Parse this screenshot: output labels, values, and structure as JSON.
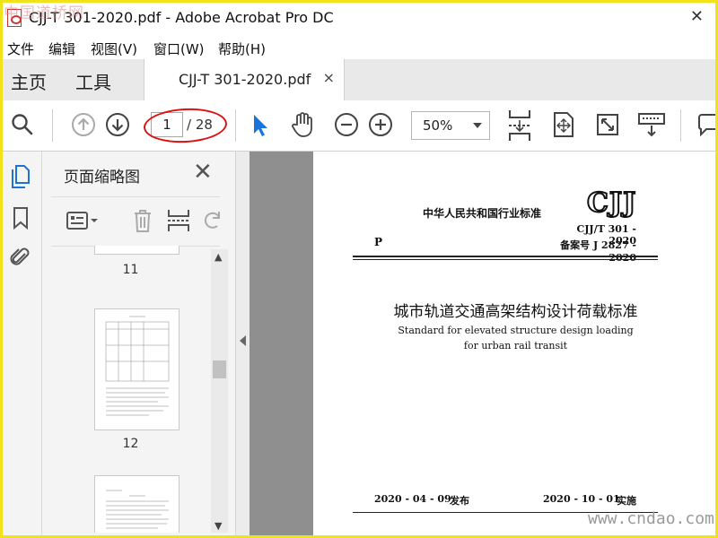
{
  "window": {
    "title": "CJJ-T 301-2020.pdf - Adobe Acrobat Pro DC",
    "watermark_top": "中国道桥网",
    "watermark_bottom": "www.cndao.com",
    "close_glyph": "✕"
  },
  "menu": [
    "文件",
    "编辑",
    "视图(V)",
    "窗口(W)",
    "帮助(H)"
  ],
  "tabs": {
    "home": "主页",
    "tools": "工具",
    "document": "CJJ-T 301-2020.pdf",
    "close_glyph": "×"
  },
  "toolbar": {
    "current_page": "1",
    "page_total": "/ 28",
    "zoom": "50%",
    "icons": [
      "search-icon",
      "previous-page-icon",
      "next-page-icon",
      "select-arrow-icon",
      "hand-tool-icon",
      "zoom-out-icon",
      "zoom-in-icon",
      "scrolling-mode-icon",
      "fit-page-icon",
      "full-screen-icon",
      "keyboard-icon",
      "comment-icon"
    ]
  },
  "left_nav": {
    "icons": [
      "page-thumbnails-icon",
      "bookmarks-icon",
      "attachments-icon"
    ]
  },
  "thumbnail_panel": {
    "title": "页面缩略图",
    "close_glyph": "✕",
    "thumbnails": [
      {
        "page": "11"
      },
      {
        "page": "12"
      }
    ]
  },
  "document": {
    "standard_title": "中华人民共和国行业标准",
    "logo": "CJJ",
    "category": "P",
    "code": "CJJ/T 301 - 2020",
    "record": "备案号  J 2827 - 2020",
    "title_cn": "城市轨道交通高架结构设计荷载标准",
    "title_en_1": "Standard for elevated structure design loading",
    "title_en_2": "for urban rail transit",
    "publish_date": "2020 - 04 - 09",
    "publish_label": "发布",
    "implement_date": "2020 - 10 - 01",
    "implement_label": "实施"
  },
  "colors": {
    "frame": "#f1e21a",
    "annotation_oval": "#dd1111",
    "select_arrow": "#1a73d9",
    "doc_background": "#8f8f8f"
  }
}
